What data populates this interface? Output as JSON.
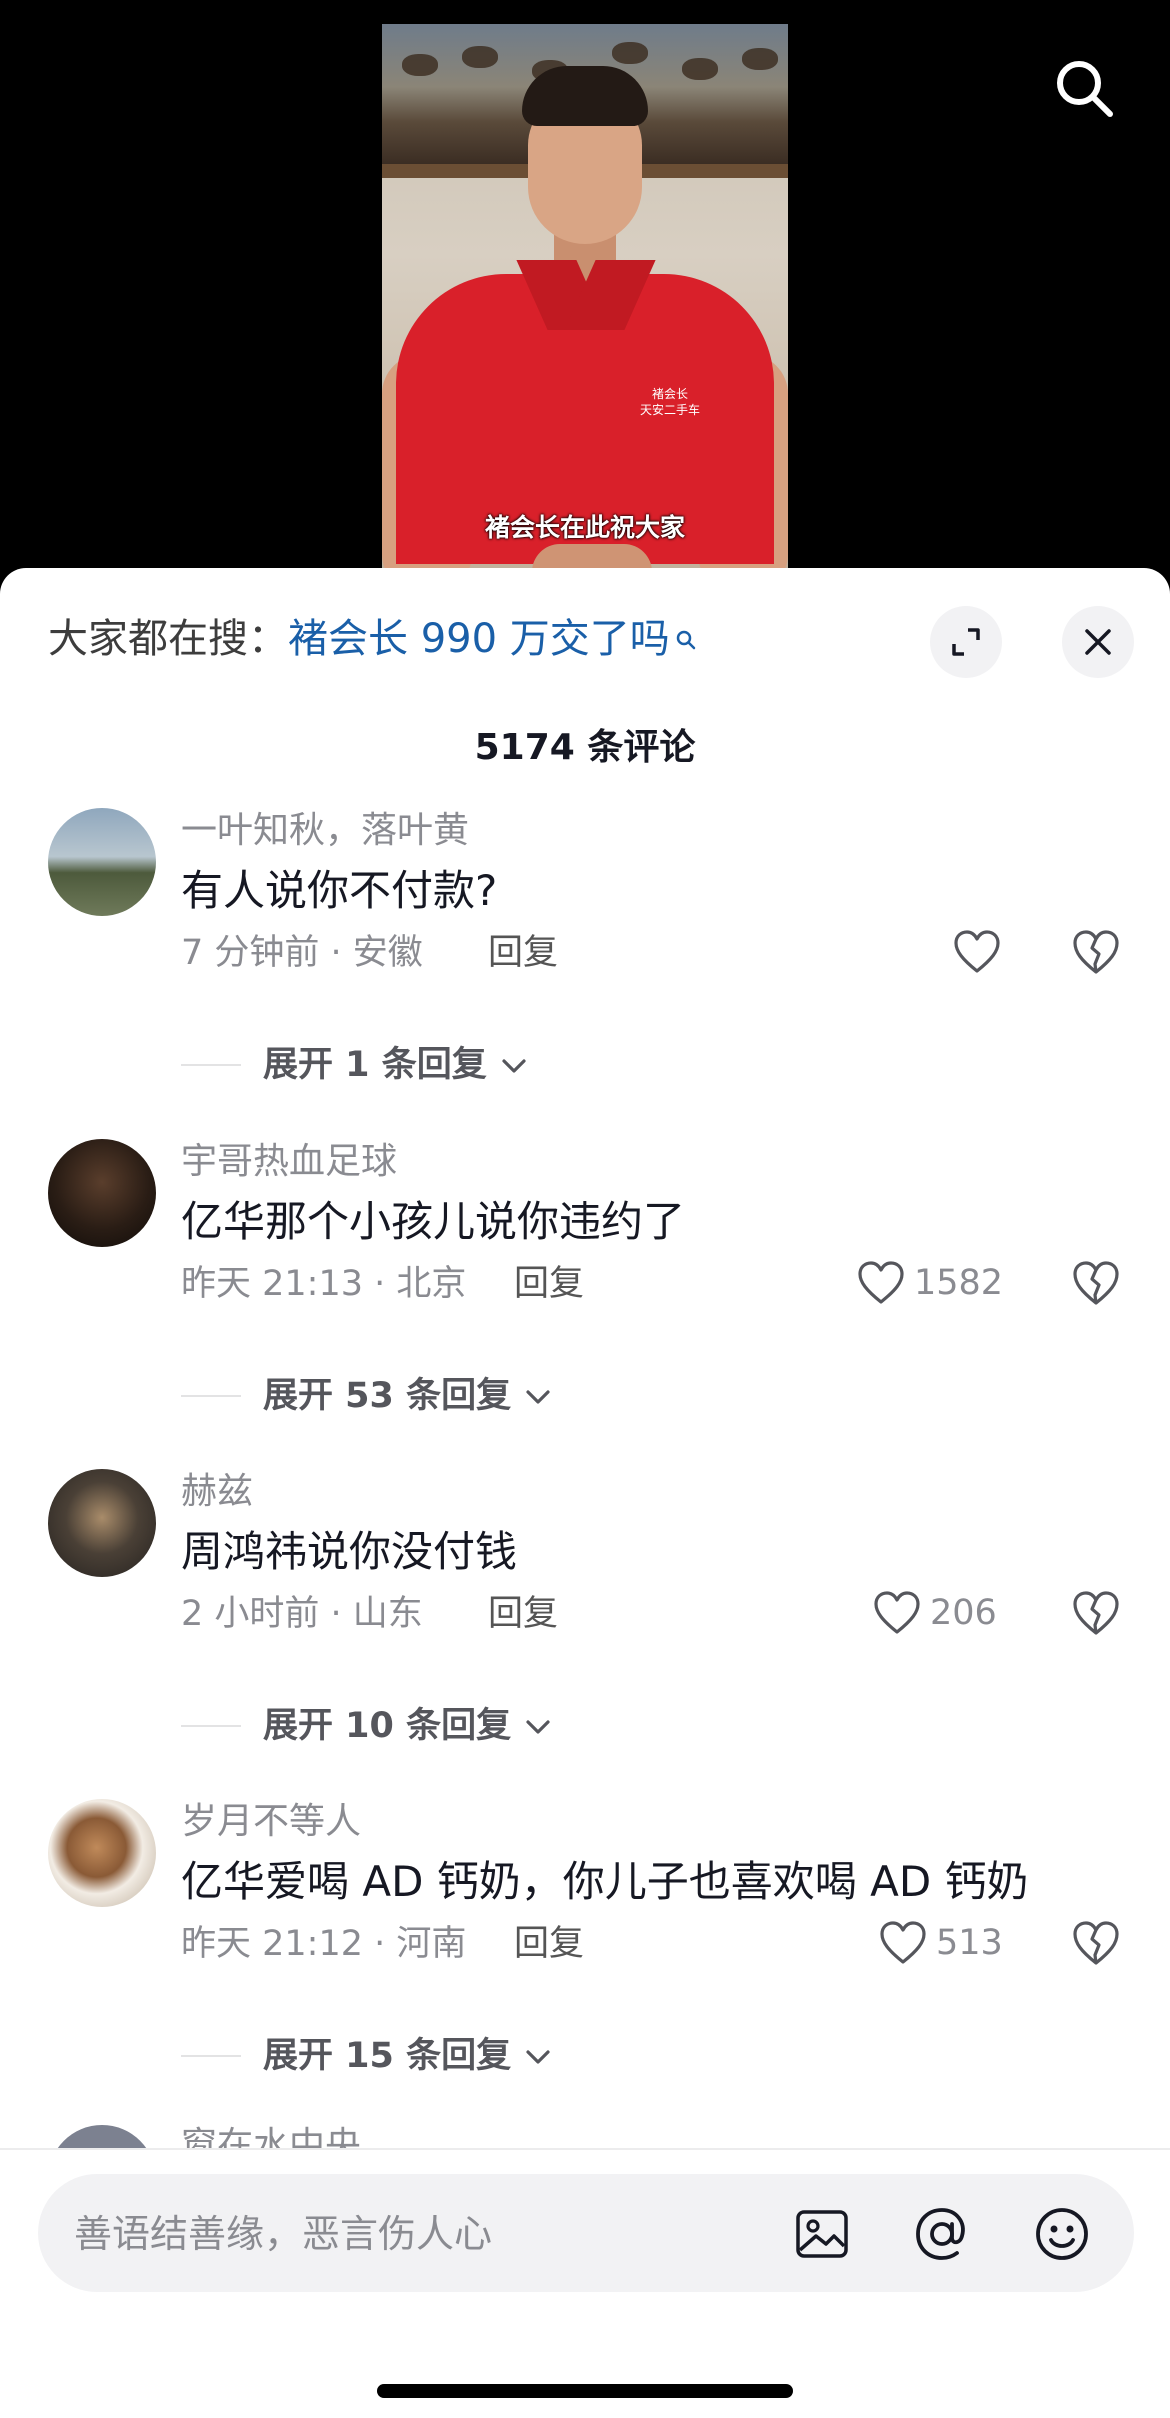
{
  "video": {
    "subtitle": "褚会长在此祝大家",
    "shirt_logo_line1": "褚会长",
    "shirt_logo_line2": "天安二手车"
  },
  "top_bar": {
    "search_icon": "search-icon"
  },
  "sheet": {
    "search_prefix": "大家都在搜：",
    "search_term": "褚会长 990 万交了吗",
    "expand_icon": "expand-icon",
    "close_icon": "close-icon",
    "comment_count": "5174 条评论"
  },
  "comments": [
    {
      "username": "一叶知秋，落叶黄",
      "text": "有人说你不付款?",
      "meta": "7 分钟前 · 安徽",
      "reply": "回复",
      "likes": "",
      "expand": "展开 1 条回复"
    },
    {
      "username": "宇哥热血足球",
      "text": "亿华那个小孩儿说你违约了",
      "meta": "昨天 21:13 · 北京",
      "reply": "回复",
      "likes": "1582",
      "expand": "展开 53 条回复"
    },
    {
      "username": "赫兹",
      "text": "周鸿祎说你没付钱",
      "meta": "2 小时前 · 山东",
      "reply": "回复",
      "likes": "206",
      "expand": "展开 10 条回复"
    },
    {
      "username": "岁月不等人",
      "text": "亿华爱喝 AD 钙奶，你儿子也喜欢喝 AD 钙奶",
      "meta": "昨天 21:12 · 河南",
      "reply": "回复",
      "likes": "513",
      "expand": "展开 15 条回复"
    }
  ],
  "partial_comment": {
    "username": "窗在水中央"
  },
  "input": {
    "placeholder": "善语结善缘，恶言伤人心",
    "icons": [
      "image-icon",
      "at-icon",
      "emoji-icon"
    ]
  },
  "colors": {
    "link_blue": "#1a5fa8",
    "text_primary": "#161823",
    "text_secondary": "#8a8b91",
    "sheet_bg": "#ffffff"
  }
}
